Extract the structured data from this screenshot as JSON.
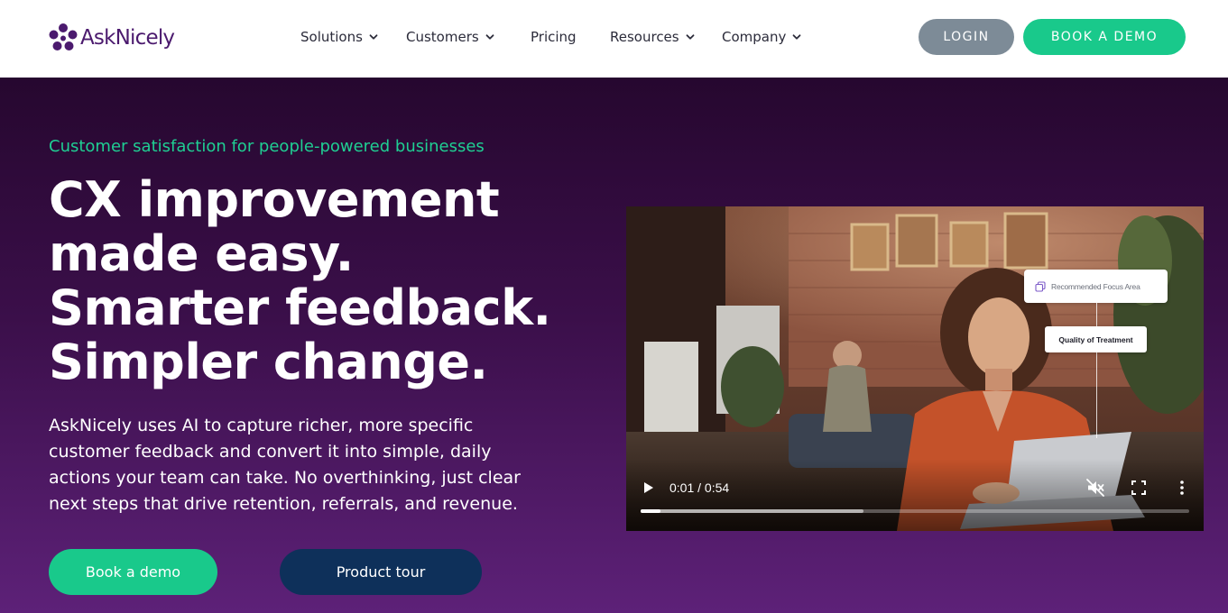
{
  "header": {
    "logo_text": "AskNicely",
    "nav": [
      {
        "label": "Solutions",
        "has_dropdown": true
      },
      {
        "label": "Customers",
        "has_dropdown": true
      },
      {
        "label": "Pricing",
        "has_dropdown": false
      },
      {
        "label": "Resources",
        "has_dropdown": true
      },
      {
        "label": "Company",
        "has_dropdown": true
      }
    ],
    "login_label": "LOGIN",
    "book_demo_label": "BOOK A DEMO"
  },
  "hero": {
    "eyebrow": "Customer satisfaction for people-powered businesses",
    "headline_lines": [
      "CX improvement",
      "made easy.",
      "Smarter feedback.",
      "Simpler change."
    ],
    "description": "AskNicely uses AI to capture richer, more specific customer feedback and convert it into simple, daily actions your team can take. No overthinking, just clear next steps that drive retention, referrals, and revenue.",
    "primary_cta": "Book a demo",
    "secondary_cta": "Product tour"
  },
  "video": {
    "callout_primary": "Recommended Focus Area",
    "callout_secondary": "Quality of Treatment",
    "time_display": "0:01 / 0:54",
    "played_fraction": 0.037,
    "buffered_fraction": 0.406,
    "muted": true
  },
  "colors": {
    "brand_purple": "#4b1a6e",
    "accent_green": "#19c98b",
    "login_gray": "#7d8b97",
    "tour_navy": "#0e305a",
    "hero_top": "#26072f",
    "hero_bottom": "#5d2178"
  },
  "icons": {
    "logo": "flower-logo-icon",
    "nav_dropdown": "chevron-down-icon",
    "callout": "layers-icon",
    "play": "play-icon",
    "mute": "volume-muted-icon",
    "fullscreen": "fullscreen-icon",
    "more": "more-vertical-icon"
  }
}
